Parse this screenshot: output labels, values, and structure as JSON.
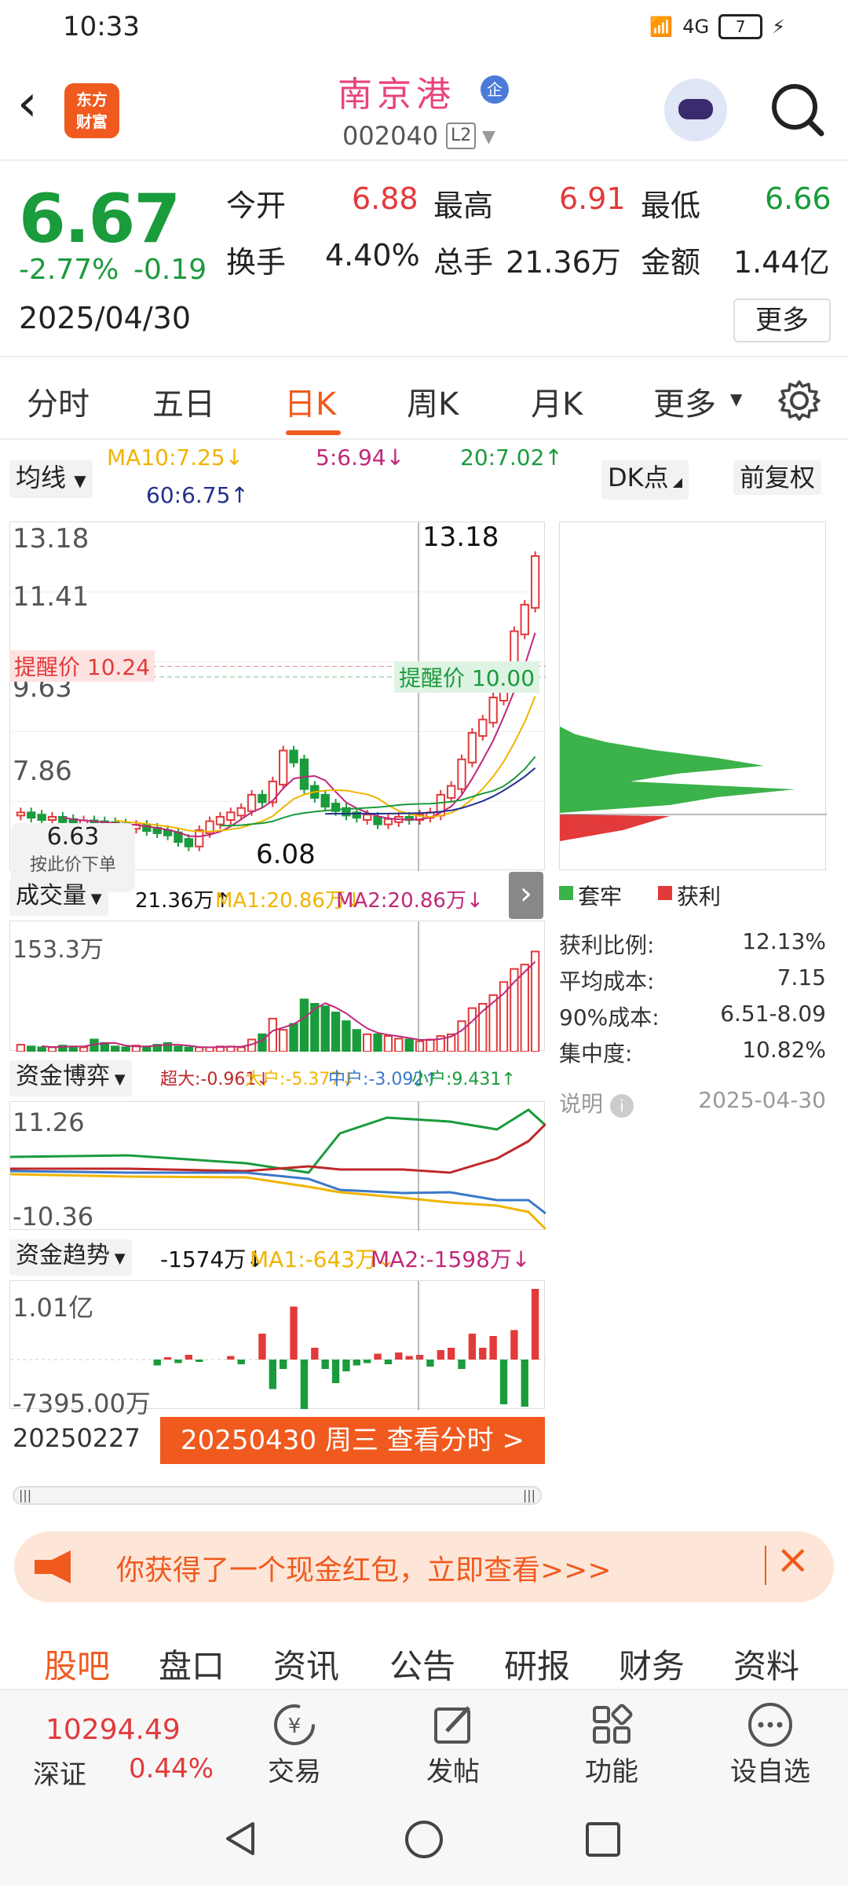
{
  "status": {
    "time": "10:33",
    "network": "4G",
    "battery": "7"
  },
  "header": {
    "name": "南京港",
    "badge": "企",
    "code": "002040",
    "level": "L2",
    "logo_line1": "东方",
    "logo_line2": "财富"
  },
  "quote": {
    "price": "6.67",
    "pct": "-2.77%",
    "chg": "-0.19",
    "date": "2025/04/30",
    "open_label": "今开",
    "open": "6.88",
    "high_label": "最高",
    "high": "6.91",
    "low_label": "最低",
    "low": "6.66",
    "turnover_label": "换手",
    "turnover": "4.40%",
    "volume_label": "总手",
    "volume": "21.36万",
    "amount_label": "金额",
    "amount": "1.44亿",
    "more": "更多"
  },
  "tabs": [
    "分时",
    "五日",
    "日K",
    "周K",
    "月K",
    "更多"
  ],
  "ma": {
    "selector": "均线",
    "ma10": "MA10:7.25↓",
    "ma5": "5:6.94↓",
    "ma20": "20:7.02↑",
    "ma60": "60:6.75↑",
    "dk": "DK点",
    "fq": "前复权"
  },
  "kline": {
    "ymax": "13.18",
    "y2": "11.41",
    "y3": "9.63",
    "y4": "7.86",
    "high_mark": "13.18",
    "low_mark": "6.08",
    "alert_left": "提醒价 10.24",
    "alert_right": "提醒价 10.00",
    "price_tag": "6.63",
    "order_hint": "按此价下单",
    "closes": [
      6.9,
      6.85,
      6.8,
      6.8,
      6.75,
      6.7,
      6.72,
      6.7,
      6.68,
      6.65,
      6.6,
      6.62,
      6.55,
      6.5,
      6.45,
      6.3,
      6.2,
      6.5,
      6.7,
      6.8,
      6.9,
      7.0,
      7.3,
      7.2,
      7.6,
      8.3,
      8.1,
      7.5,
      7.3,
      7.1,
      7.0,
      6.9,
      6.85,
      6.8,
      6.7,
      6.75,
      6.8,
      6.8,
      6.85,
      6.9,
      7.3,
      7.5,
      8.1,
      8.7,
      9.0,
      9.5,
      10.2,
      11.0,
      11.6,
      12.7
    ],
    "up_down": [
      1,
      0,
      0,
      1,
      0,
      0,
      1,
      0,
      0,
      0,
      0,
      1,
      0,
      0,
      0,
      0,
      0,
      1,
      1,
      1,
      1,
      1,
      1,
      0,
      1,
      1,
      0,
      0,
      0,
      0,
      0,
      0,
      0,
      1,
      0,
      1,
      1,
      0,
      1,
      1,
      1,
      1,
      1,
      1,
      1,
      1,
      1,
      1,
      1,
      1
    ]
  },
  "volume": {
    "selector": "成交量",
    "val": "21.36万↑",
    "ma1": "MA1:20.86万↓",
    "ma2": "MA2:20.86万↓",
    "ymax": "153.3万",
    "bars": [
      8,
      6,
      5,
      5,
      7,
      6,
      5,
      14,
      10,
      6,
      5,
      7,
      6,
      8,
      10,
      6,
      5,
      5,
      5,
      6,
      6,
      5,
      14,
      20,
      38,
      25,
      32,
      60,
      55,
      52,
      45,
      35,
      25,
      20,
      20,
      18,
      15,
      14,
      12,
      14,
      18,
      20,
      35,
      50,
      55,
      65,
      80,
      95,
      100,
      115
    ]
  },
  "fund_game": {
    "selector": "资金博弈",
    "super": "超大:-0.961↓",
    "large": "大户:-5.377↓",
    "medium": "中户:-3.092↑",
    "small": "小户:9.431↑",
    "ymax": "11.26",
    "ymin": "-10.36"
  },
  "fund_trend": {
    "selector": "资金趋势",
    "val": "-1574万↓",
    "ma1": "MA1:-643万↓",
    "ma2": "MA2:-1598万↓",
    "ymax": "1.01亿",
    "ymin": "-7395.00万",
    "bars": [
      0,
      0,
      0,
      0,
      0,
      0,
      0,
      0,
      0,
      0,
      0,
      0,
      0,
      -5,
      2,
      -3,
      4,
      -2,
      0,
      0,
      3,
      -4,
      0,
      22,
      -25,
      -8,
      45,
      -42,
      10,
      -8,
      -20,
      -10,
      -5,
      -3,
      5,
      -4,
      6,
      3,
      4,
      -6,
      8,
      10,
      -8,
      22,
      10,
      20,
      -38,
      25,
      -40,
      60
    ]
  },
  "time_axis": {
    "start": "20250227",
    "current": "20250430 周三 查看分时 >"
  },
  "chip": {
    "legend_hold": "套牢",
    "legend_profit": "获利",
    "rows": [
      {
        "label": "获利比例:",
        "value": "12.13%"
      },
      {
        "label": "平均成本:",
        "value": "7.15"
      },
      {
        "label": "90%成本:",
        "value": "6.51-8.09"
      },
      {
        "label": "集中度:",
        "value": "10.82%"
      }
    ],
    "note_label": "说明",
    "note_date": "2025-04-30"
  },
  "announcement": "你获得了一个现金红包，立即查看>>>",
  "bottom_tabs": [
    "股吧",
    "盘口",
    "资讯",
    "公告",
    "研报",
    "财务",
    "资料"
  ],
  "dock": {
    "index_value": "10294.49",
    "index_name": "深证",
    "index_pct": "0.44%",
    "trade": "交易",
    "post": "发帖",
    "func": "功能",
    "watch": "设自选"
  },
  "colors": {
    "up": "#e23a3a",
    "down": "#1a9b3c",
    "accent": "#f05a1e",
    "ma5": "#c0287a",
    "ma10": "#f0b400",
    "ma20": "#1a9b3c",
    "ma60": "#23308c"
  }
}
